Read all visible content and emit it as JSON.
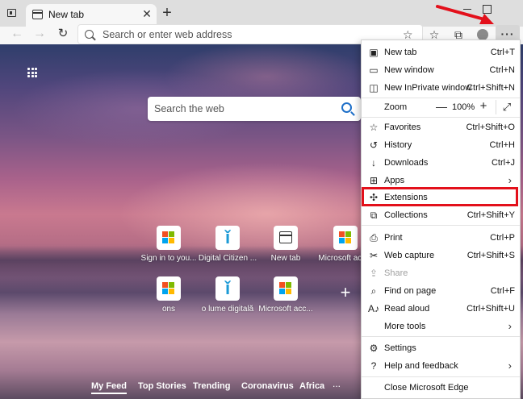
{
  "tab": {
    "title": "New tab",
    "close": "✕"
  },
  "new_tab_button": "+",
  "address": {
    "placeholder": "Search or enter web address"
  },
  "toolbar": {
    "more_label": "···"
  },
  "ntp": {
    "search_placeholder": "Search the web",
    "tiles": [
      {
        "label": "Sign in to you...",
        "icon": "microsoft-icon"
      },
      {
        "label": "Digital Citizen ...",
        "icon": "digital-citizen-icon"
      },
      {
        "label": "New tab",
        "icon": "new-tab-icon"
      },
      {
        "label": "Microsoft acc...",
        "icon": "microsoft-icon"
      },
      {
        "label": "ons",
        "icon": "microsoft-icon"
      },
      {
        "label": "o lume digitală",
        "icon": "digital-citizen-icon"
      },
      {
        "label": "Microsoft acc...",
        "icon": "microsoft-icon"
      }
    ],
    "add_tile": "+",
    "feed_tabs": [
      "My Feed",
      "Top Stories",
      "Trending",
      "Coronavirus",
      "Africa"
    ],
    "feed_more": "..."
  },
  "menu": {
    "new_tab": {
      "label": "New tab",
      "shortcut": "Ctrl+T"
    },
    "new_window": {
      "label": "New window",
      "shortcut": "Ctrl+N"
    },
    "inprivate": {
      "label": "New InPrivate window",
      "shortcut": "Ctrl+Shift+N"
    },
    "zoom": {
      "label": "Zoom",
      "minus": "—",
      "value": "100%",
      "plus": "+",
      "fullscreen": "⤢"
    },
    "favorites": {
      "label": "Favorites",
      "shortcut": "Ctrl+Shift+O"
    },
    "history": {
      "label": "History",
      "shortcut": "Ctrl+H"
    },
    "downloads": {
      "label": "Downloads",
      "shortcut": "Ctrl+J"
    },
    "apps": {
      "label": "Apps"
    },
    "extensions": {
      "label": "Extensions"
    },
    "collections": {
      "label": "Collections",
      "shortcut": "Ctrl+Shift+Y"
    },
    "print": {
      "label": "Print",
      "shortcut": "Ctrl+P"
    },
    "web_capture": {
      "label": "Web capture",
      "shortcut": "Ctrl+Shift+S"
    },
    "share": {
      "label": "Share"
    },
    "find": {
      "label": "Find on page",
      "shortcut": "Ctrl+F"
    },
    "read_aloud": {
      "label": "Read aloud",
      "shortcut": "Ctrl+Shift+U"
    },
    "more_tools": {
      "label": "More tools"
    },
    "settings": {
      "label": "Settings"
    },
    "help": {
      "label": "Help and feedback"
    },
    "close": {
      "label": "Close Microsoft Edge"
    }
  },
  "colors": {
    "highlight": "#e3101b",
    "accent": "#1e6fc8"
  }
}
